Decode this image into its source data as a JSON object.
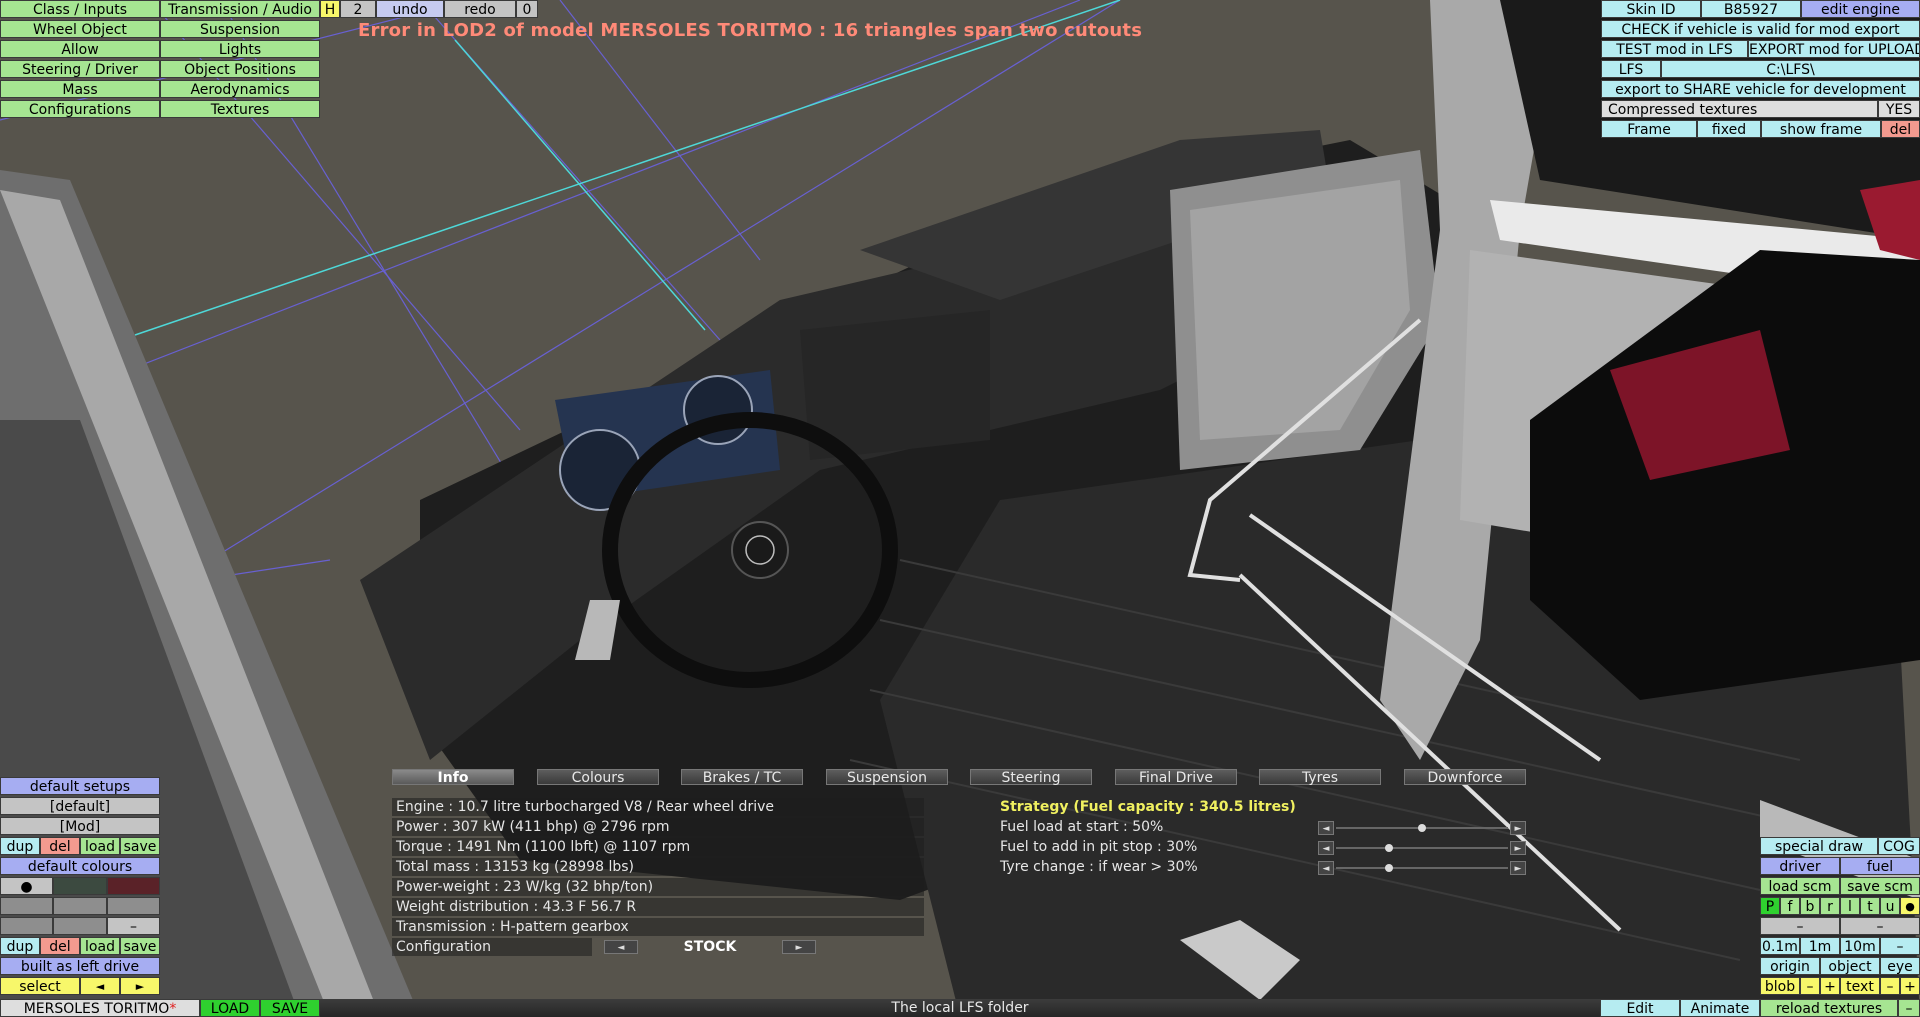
{
  "top_menu": {
    "col1": [
      "Class / Inputs",
      "Wheel Object",
      "Allow",
      "Steering / Driver",
      "Mass",
      "Configurations"
    ],
    "col2": [
      "Transmission / Audio",
      "Suspension",
      "Lights",
      "Object Positions",
      "Aerodynamics",
      "Textures"
    ]
  },
  "toolbar": {
    "h": "H",
    "count": "2",
    "undo": "undo",
    "redo": "redo",
    "redo_count": "0"
  },
  "error_message": "Error in LOD2 of model MERSOLES TORITMO : 16 triangles span two cutouts",
  "right_panel": {
    "skin_id_label": "Skin ID",
    "skin_id_value": "B85927",
    "edit_engine": "edit engine",
    "check": "CHECK if vehicle is valid for mod export",
    "test": "TEST mod in LFS",
    "export": "EXPORT mod for UPLOAD",
    "lfs_label": "LFS",
    "lfs_path": "C:\\LFS\\",
    "share": "export to SHARE vehicle for development",
    "compressed_label": "Compressed textures",
    "compressed_value": "YES",
    "frame": "Frame",
    "fixed": "fixed",
    "show_frame": "show frame",
    "del": "del"
  },
  "tabs": [
    "Info",
    "Colours",
    "Brakes / TC",
    "Suspension",
    "Steering",
    "Final Drive",
    "Tyres",
    "Downforce"
  ],
  "info_lines": [
    "Engine : 10.7 litre turbocharged V8 / Rear wheel drive",
    "Power : 307 kW (411 bhp) @ 2796 rpm",
    "Torque : 1491 Nm (1100 lbft) @ 1107 rpm",
    "Total mass : 13153 kg (28998 lbs)",
    "Power-weight : 23 W/kg (32 bhp/ton)",
    "Weight distribution : 43.3 F  56.7 R",
    "Transmission : H-pattern gearbox"
  ],
  "configuration": {
    "label": "Configuration",
    "value": "STOCK"
  },
  "strategy": {
    "title": "Strategy (Fuel capacity : 340.5 litres)",
    "rows": [
      {
        "label": "Fuel load at start : 50%",
        "level": 0.5
      },
      {
        "label": "Fuel to add in pit stop : 30%",
        "level": 0.3
      },
      {
        "label": "Tyre change : if wear > 30%",
        "level": 0.3
      }
    ]
  },
  "left_panel": {
    "default_setups": "default setups",
    "default": "[default]",
    "mod": "[Mod]",
    "dup": "dup",
    "del": "del",
    "load": "load",
    "save": "save",
    "default_colours": "default colours",
    "bullet": "●",
    "dash": "–",
    "built_as": "built as left drive",
    "select": "select",
    "left_arrow": "◄",
    "right_arrow": "►",
    "colour_swatches": [
      "#c8c8c8",
      "#3c4a40",
      "#5a2228"
    ]
  },
  "bottom_left": {
    "vehicle_name": "MERSOLES TORITMO",
    "modified_mark": "*",
    "load": "LOAD",
    "save": "SAVE"
  },
  "status_text": "The local LFS folder",
  "bottom_right": {
    "special_draw": "special draw",
    "cog": "COG",
    "driver": "driver",
    "fuel": "fuel",
    "load_scm": "load scm",
    "save_scm": "save scm",
    "letters": [
      "P",
      "f",
      "b",
      "r",
      "l",
      "t",
      "u"
    ],
    "dot": "●",
    "dash": "–",
    "scale": [
      "0.1m",
      "1m",
      "10m",
      "–"
    ],
    "origin": "origin",
    "object": "object",
    "eye": "eye",
    "blob": "blob",
    "minus": "–",
    "plus": "+",
    "text": "text",
    "edit": "Edit",
    "animate": "Animate",
    "reload_textures": "reload textures",
    "end_dash": "–"
  }
}
